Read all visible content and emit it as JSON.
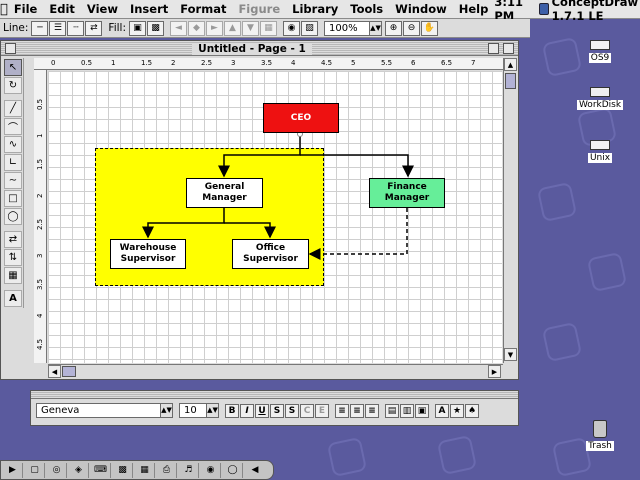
{
  "menubar": {
    "items": [
      "File",
      "Edit",
      "View",
      "Insert",
      "Format",
      "Figure",
      "Library",
      "Tools",
      "Window",
      "Help"
    ],
    "disabled_item": "Figure",
    "clock": "3:11 PM",
    "app_name": "ConceptDraw 1.7.1 LE"
  },
  "toolbar": {
    "line_label": "Line:",
    "fill_label": "Fill:",
    "zoom_value": "100%"
  },
  "window": {
    "title": "Untitled - Page - 1",
    "ruler_top": [
      "0",
      "0.5",
      "1",
      "1.5",
      "2",
      "2.5",
      "3",
      "3.5",
      "4",
      "4.5",
      "5",
      "5.5",
      "6",
      "6.5",
      "7"
    ],
    "ruler_left": [
      "0.5",
      "1",
      "1.5",
      "2",
      "2.5",
      "3",
      "3.5",
      "4",
      "4.5"
    ],
    "ruler_unit": "in"
  },
  "diagram": {
    "ceo": "CEO",
    "general_manager": [
      "General",
      "Manager"
    ],
    "finance_manager": [
      "Finance",
      "Manager"
    ],
    "warehouse_supervisor": [
      "Warehouse",
      "Supervisor"
    ],
    "office_supervisor": [
      "Office",
      "Supervisor"
    ],
    "colors": {
      "ceo": "#ee1111",
      "finance": "#66ee99",
      "region": "#ffff00",
      "box": "#ffffff"
    }
  },
  "text_palette": {
    "font": "Geneva",
    "size": "10",
    "style_buttons": [
      "B",
      "I",
      "U",
      "S",
      "S",
      "C",
      "E"
    ]
  },
  "desktop": {
    "icons": [
      "OS9",
      "WorkDisk",
      "Unix",
      "Trash"
    ]
  }
}
